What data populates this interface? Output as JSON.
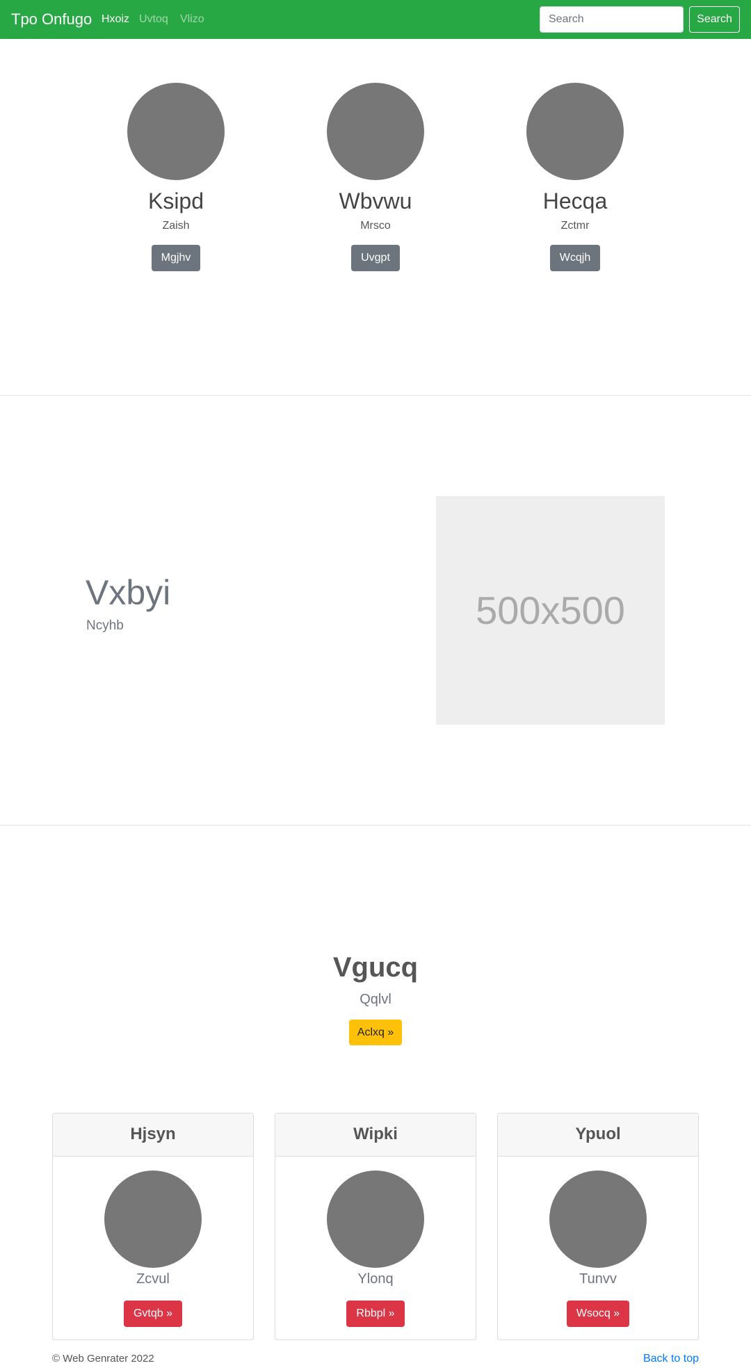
{
  "navbar": {
    "brand": "Tpo Onfugo",
    "links": [
      {
        "label": "Hxoiz",
        "active": true
      },
      {
        "label": "Uvtoq",
        "active": false
      },
      {
        "label": "Vlizo",
        "active": false
      }
    ],
    "search_placeholder": "Search",
    "search_button": "Search",
    "color": "#28a745"
  },
  "team": [
    {
      "name": "Ksipd",
      "role": "Zaish",
      "button": "Mgjhv"
    },
    {
      "name": "Wbvwu",
      "role": "Mrsco",
      "button": "Uvgpt"
    },
    {
      "name": "Hecqa",
      "role": "Zctmr",
      "button": "Wcqjh"
    }
  ],
  "feature": {
    "title": "Vxbyi",
    "subtitle": "Ncyhb",
    "image_text": "500x500"
  },
  "hero": {
    "title": "Vgucq",
    "subtitle": "Qqlvl",
    "button": "Aclxq »"
  },
  "cards": [
    {
      "header": "Hjsyn",
      "text": "Zcvul",
      "button": "Gvtqb »"
    },
    {
      "header": "Wipki",
      "text": "Ylonq",
      "button": "Rbbpl »"
    },
    {
      "header": "Ypuol",
      "text": "Tunvv",
      "button": "Wsocq »"
    }
  ],
  "footer": {
    "copyright": "© Web Genrater 2022",
    "back_to_top": "Back to top"
  }
}
